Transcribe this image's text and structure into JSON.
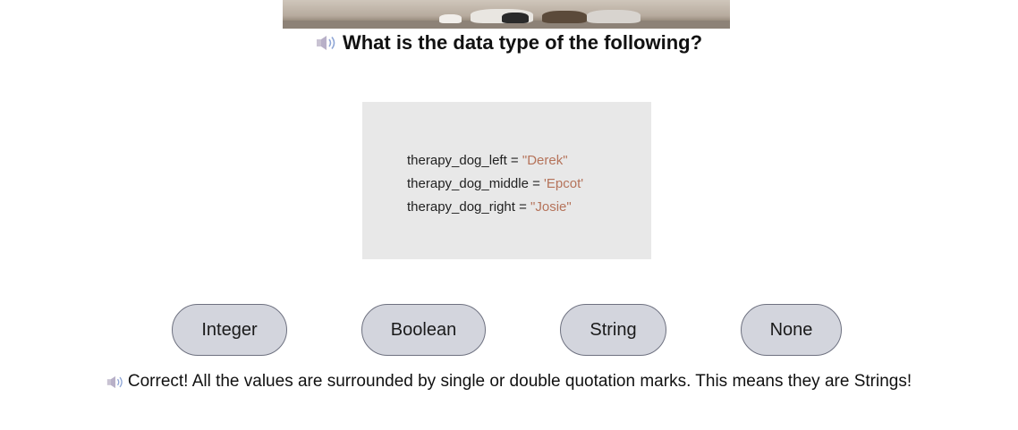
{
  "header_image": {
    "icon": "dogs-photo"
  },
  "question": {
    "speaker_icon": "speaker-icon",
    "text": "What is the data type of the following?"
  },
  "code": {
    "lines": [
      {
        "name": "therapy_dog_left",
        "op": " = ",
        "value": "\"Derek\""
      },
      {
        "name": "therapy_dog_middle",
        "op": " = ",
        "value": "'Epcot'"
      },
      {
        "name": "therapy_dog_right",
        "op": " = ",
        "value": "\"Josie\""
      }
    ],
    "string_color": "#b5735a",
    "background": "#e8e8e8"
  },
  "answers": [
    {
      "label": "Integer"
    },
    {
      "label": "Boolean"
    },
    {
      "label": "String"
    },
    {
      "label": "None"
    }
  ],
  "button_color": "#d3d5dd",
  "feedback": {
    "speaker_icon": "speaker-icon",
    "text": "Correct! All the values are surrounded by single or double quotation marks. This means they are Strings!"
  }
}
